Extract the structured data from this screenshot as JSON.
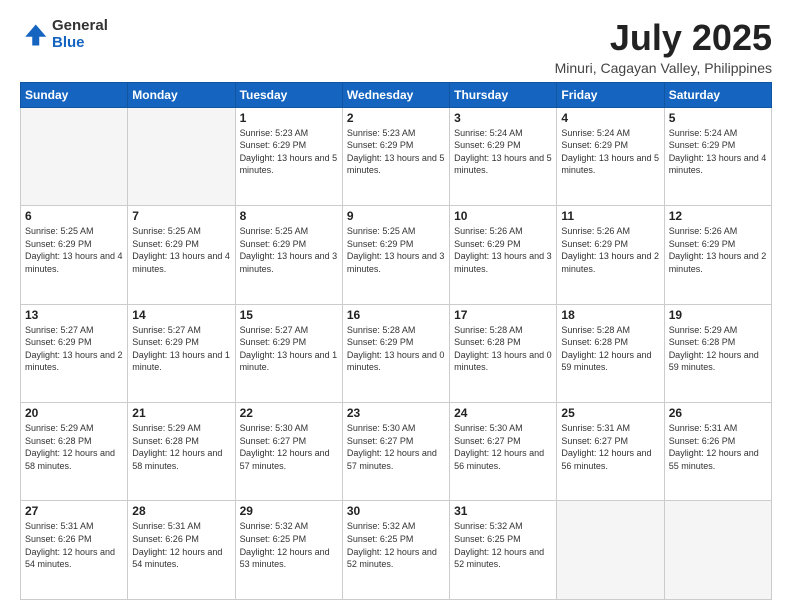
{
  "logo": {
    "general": "General",
    "blue": "Blue"
  },
  "title": "July 2025",
  "subtitle": "Minuri, Cagayan Valley, Philippines",
  "weekdays": [
    "Sunday",
    "Monday",
    "Tuesday",
    "Wednesday",
    "Thursday",
    "Friday",
    "Saturday"
  ],
  "weeks": [
    [
      {
        "day": "",
        "info": ""
      },
      {
        "day": "",
        "info": ""
      },
      {
        "day": "1",
        "info": "Sunrise: 5:23 AM\nSunset: 6:29 PM\nDaylight: 13 hours and 5 minutes."
      },
      {
        "day": "2",
        "info": "Sunrise: 5:23 AM\nSunset: 6:29 PM\nDaylight: 13 hours and 5 minutes."
      },
      {
        "day": "3",
        "info": "Sunrise: 5:24 AM\nSunset: 6:29 PM\nDaylight: 13 hours and 5 minutes."
      },
      {
        "day": "4",
        "info": "Sunrise: 5:24 AM\nSunset: 6:29 PM\nDaylight: 13 hours and 5 minutes."
      },
      {
        "day": "5",
        "info": "Sunrise: 5:24 AM\nSunset: 6:29 PM\nDaylight: 13 hours and 4 minutes."
      }
    ],
    [
      {
        "day": "6",
        "info": "Sunrise: 5:25 AM\nSunset: 6:29 PM\nDaylight: 13 hours and 4 minutes."
      },
      {
        "day": "7",
        "info": "Sunrise: 5:25 AM\nSunset: 6:29 PM\nDaylight: 13 hours and 4 minutes."
      },
      {
        "day": "8",
        "info": "Sunrise: 5:25 AM\nSunset: 6:29 PM\nDaylight: 13 hours and 3 minutes."
      },
      {
        "day": "9",
        "info": "Sunrise: 5:25 AM\nSunset: 6:29 PM\nDaylight: 13 hours and 3 minutes."
      },
      {
        "day": "10",
        "info": "Sunrise: 5:26 AM\nSunset: 6:29 PM\nDaylight: 13 hours and 3 minutes."
      },
      {
        "day": "11",
        "info": "Sunrise: 5:26 AM\nSunset: 6:29 PM\nDaylight: 13 hours and 2 minutes."
      },
      {
        "day": "12",
        "info": "Sunrise: 5:26 AM\nSunset: 6:29 PM\nDaylight: 13 hours and 2 minutes."
      }
    ],
    [
      {
        "day": "13",
        "info": "Sunrise: 5:27 AM\nSunset: 6:29 PM\nDaylight: 13 hours and 2 minutes."
      },
      {
        "day": "14",
        "info": "Sunrise: 5:27 AM\nSunset: 6:29 PM\nDaylight: 13 hours and 1 minute."
      },
      {
        "day": "15",
        "info": "Sunrise: 5:27 AM\nSunset: 6:29 PM\nDaylight: 13 hours and 1 minute."
      },
      {
        "day": "16",
        "info": "Sunrise: 5:28 AM\nSunset: 6:29 PM\nDaylight: 13 hours and 0 minutes."
      },
      {
        "day": "17",
        "info": "Sunrise: 5:28 AM\nSunset: 6:28 PM\nDaylight: 13 hours and 0 minutes."
      },
      {
        "day": "18",
        "info": "Sunrise: 5:28 AM\nSunset: 6:28 PM\nDaylight: 12 hours and 59 minutes."
      },
      {
        "day": "19",
        "info": "Sunrise: 5:29 AM\nSunset: 6:28 PM\nDaylight: 12 hours and 59 minutes."
      }
    ],
    [
      {
        "day": "20",
        "info": "Sunrise: 5:29 AM\nSunset: 6:28 PM\nDaylight: 12 hours and 58 minutes."
      },
      {
        "day": "21",
        "info": "Sunrise: 5:29 AM\nSunset: 6:28 PM\nDaylight: 12 hours and 58 minutes."
      },
      {
        "day": "22",
        "info": "Sunrise: 5:30 AM\nSunset: 6:27 PM\nDaylight: 12 hours and 57 minutes."
      },
      {
        "day": "23",
        "info": "Sunrise: 5:30 AM\nSunset: 6:27 PM\nDaylight: 12 hours and 57 minutes."
      },
      {
        "day": "24",
        "info": "Sunrise: 5:30 AM\nSunset: 6:27 PM\nDaylight: 12 hours and 56 minutes."
      },
      {
        "day": "25",
        "info": "Sunrise: 5:31 AM\nSunset: 6:27 PM\nDaylight: 12 hours and 56 minutes."
      },
      {
        "day": "26",
        "info": "Sunrise: 5:31 AM\nSunset: 6:26 PM\nDaylight: 12 hours and 55 minutes."
      }
    ],
    [
      {
        "day": "27",
        "info": "Sunrise: 5:31 AM\nSunset: 6:26 PM\nDaylight: 12 hours and 54 minutes."
      },
      {
        "day": "28",
        "info": "Sunrise: 5:31 AM\nSunset: 6:26 PM\nDaylight: 12 hours and 54 minutes."
      },
      {
        "day": "29",
        "info": "Sunrise: 5:32 AM\nSunset: 6:25 PM\nDaylight: 12 hours and 53 minutes."
      },
      {
        "day": "30",
        "info": "Sunrise: 5:32 AM\nSunset: 6:25 PM\nDaylight: 12 hours and 52 minutes."
      },
      {
        "day": "31",
        "info": "Sunrise: 5:32 AM\nSunset: 6:25 PM\nDaylight: 12 hours and 52 minutes."
      },
      {
        "day": "",
        "info": ""
      },
      {
        "day": "",
        "info": ""
      }
    ]
  ]
}
